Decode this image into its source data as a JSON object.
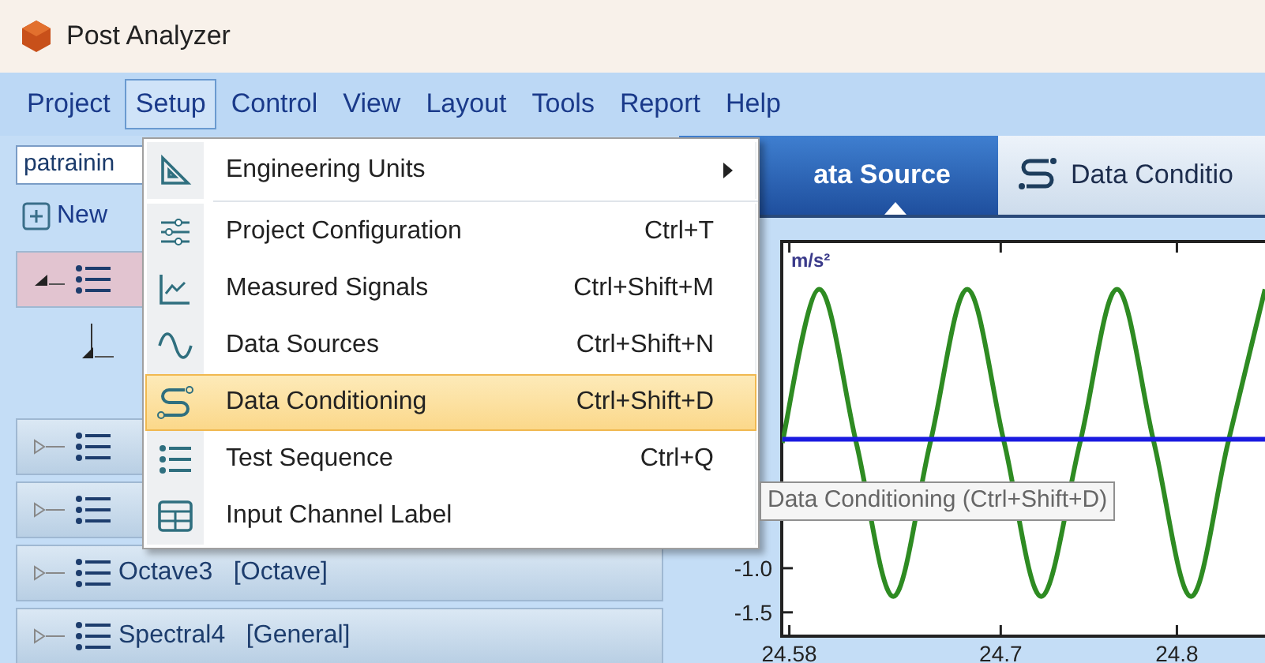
{
  "window": {
    "title": "Post Analyzer"
  },
  "menubar": [
    {
      "label": "Project",
      "selected": false
    },
    {
      "label": "Setup",
      "selected": true
    },
    {
      "label": "Control",
      "selected": false
    },
    {
      "label": "View",
      "selected": false
    },
    {
      "label": "Layout",
      "selected": false
    },
    {
      "label": "Tools",
      "selected": false
    },
    {
      "label": "Report",
      "selected": false
    },
    {
      "label": "Help",
      "selected": false
    }
  ],
  "project_dropdown": {
    "value": "patrainin"
  },
  "new_button": {
    "label": "New"
  },
  "tree": [
    {
      "expanded": true,
      "selected": true
    },
    {
      "expanded": false,
      "selected": false
    },
    {
      "expanded": false,
      "selected": false
    },
    {
      "label": "Octave3   [Octave]",
      "expanded": false,
      "selected": false
    },
    {
      "label": "Spectral4   [General]",
      "expanded": false,
      "selected": false
    }
  ],
  "tabs": [
    {
      "label": "ata Source",
      "selected": true
    },
    {
      "label": "Data Conditio",
      "selected": false
    }
  ],
  "setup_menu": [
    {
      "kind": "submenu",
      "label": "Engineering Units",
      "selected": false
    },
    {
      "kind": "item",
      "label": "Project Configuration",
      "shortcut": "Ctrl+T",
      "selected": false
    },
    {
      "kind": "item",
      "label": "Measured Signals",
      "shortcut": "Ctrl+Shift+M",
      "selected": false
    },
    {
      "kind": "item",
      "label": "Data Sources",
      "shortcut": "Ctrl+Shift+N",
      "selected": false
    },
    {
      "kind": "item",
      "label": "Data Conditioning",
      "shortcut": "Ctrl+Shift+D",
      "selected": true
    },
    {
      "kind": "item",
      "label": "Test Sequence",
      "shortcut": "Ctrl+Q",
      "selected": false
    },
    {
      "kind": "item",
      "label": "Input Channel Label",
      "selected": false
    }
  ],
  "tooltip": "Data Conditioning (Ctrl+Shift+D)",
  "plot": {
    "chart_data": {
      "type": "line",
      "ylabel": "m/s²",
      "x": [
        24.576,
        24.597,
        24.618,
        24.639,
        24.66,
        24.681,
        24.702,
        24.723,
        24.745,
        24.766,
        24.787,
        24.808,
        24.829,
        24.85
      ],
      "series": [
        {
          "color": "#2e8b22",
          "values": [
            0.42,
            2.16,
            0.42,
            -1.32,
            0.42,
            2.16,
            0.42,
            -1.32,
            0.42,
            2.16,
            0.42,
            -1.32,
            0.42,
            2.16
          ]
        },
        {
          "color": "#1a1ae0",
          "values": [
            0.46,
            0.46,
            0.46,
            0.46,
            0.46,
            0.46,
            0.46,
            0.46,
            0.46,
            0.46,
            0.46,
            0.46,
            0.46,
            0.46
          ]
        }
      ],
      "xlim": [
        24.5757,
        24.85
      ],
      "ylim": [
        -1.77,
        2.7
      ],
      "xticks": [
        {
          "value": 24.58,
          "label": "24.58"
        },
        {
          "value": 24.7,
          "label": "24.7"
        },
        {
          "value": 24.8,
          "label": "24.8"
        }
      ],
      "yticks": [
        {
          "value": -1.0,
          "label": "-1.0"
        },
        {
          "value": -1.5,
          "label": "-1.5"
        }
      ]
    }
  }
}
